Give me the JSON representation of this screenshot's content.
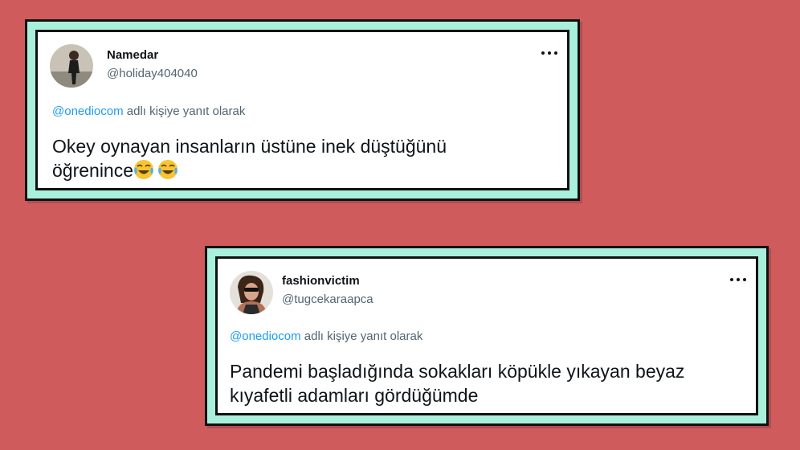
{
  "tweets": [
    {
      "display_name": "Namedar",
      "handle": "@holiday404040",
      "reply_mention": "@onediocom",
      "reply_suffix": "adlı kişiye yanıt olarak",
      "text_line1": "Okey oynayan insanların üstüne inek düştüğünü",
      "text_line2": "öğrenince",
      "emojis": [
        "face-with-tears-of-joy-icon",
        "face-with-tears-of-joy-icon"
      ],
      "avatar_icon": "profile-photo-icon"
    },
    {
      "display_name": "fashionvictim",
      "handle": "@tugcekaraapca",
      "reply_mention": "@onediocom",
      "reply_suffix": "adlı kişiye yanıt olarak",
      "text_line1": "Pandemi başladığında sokakları köpükle yıkayan beyaz",
      "text_line2": "kıyafetli adamları gördüğümde",
      "avatar_icon": "profile-photo-icon"
    }
  ],
  "colors": {
    "background": "#cf5b5d",
    "frame": "#a9f0dc",
    "mention": "#1d9bf0",
    "text": "#0f1419",
    "secondary": "#536471"
  }
}
